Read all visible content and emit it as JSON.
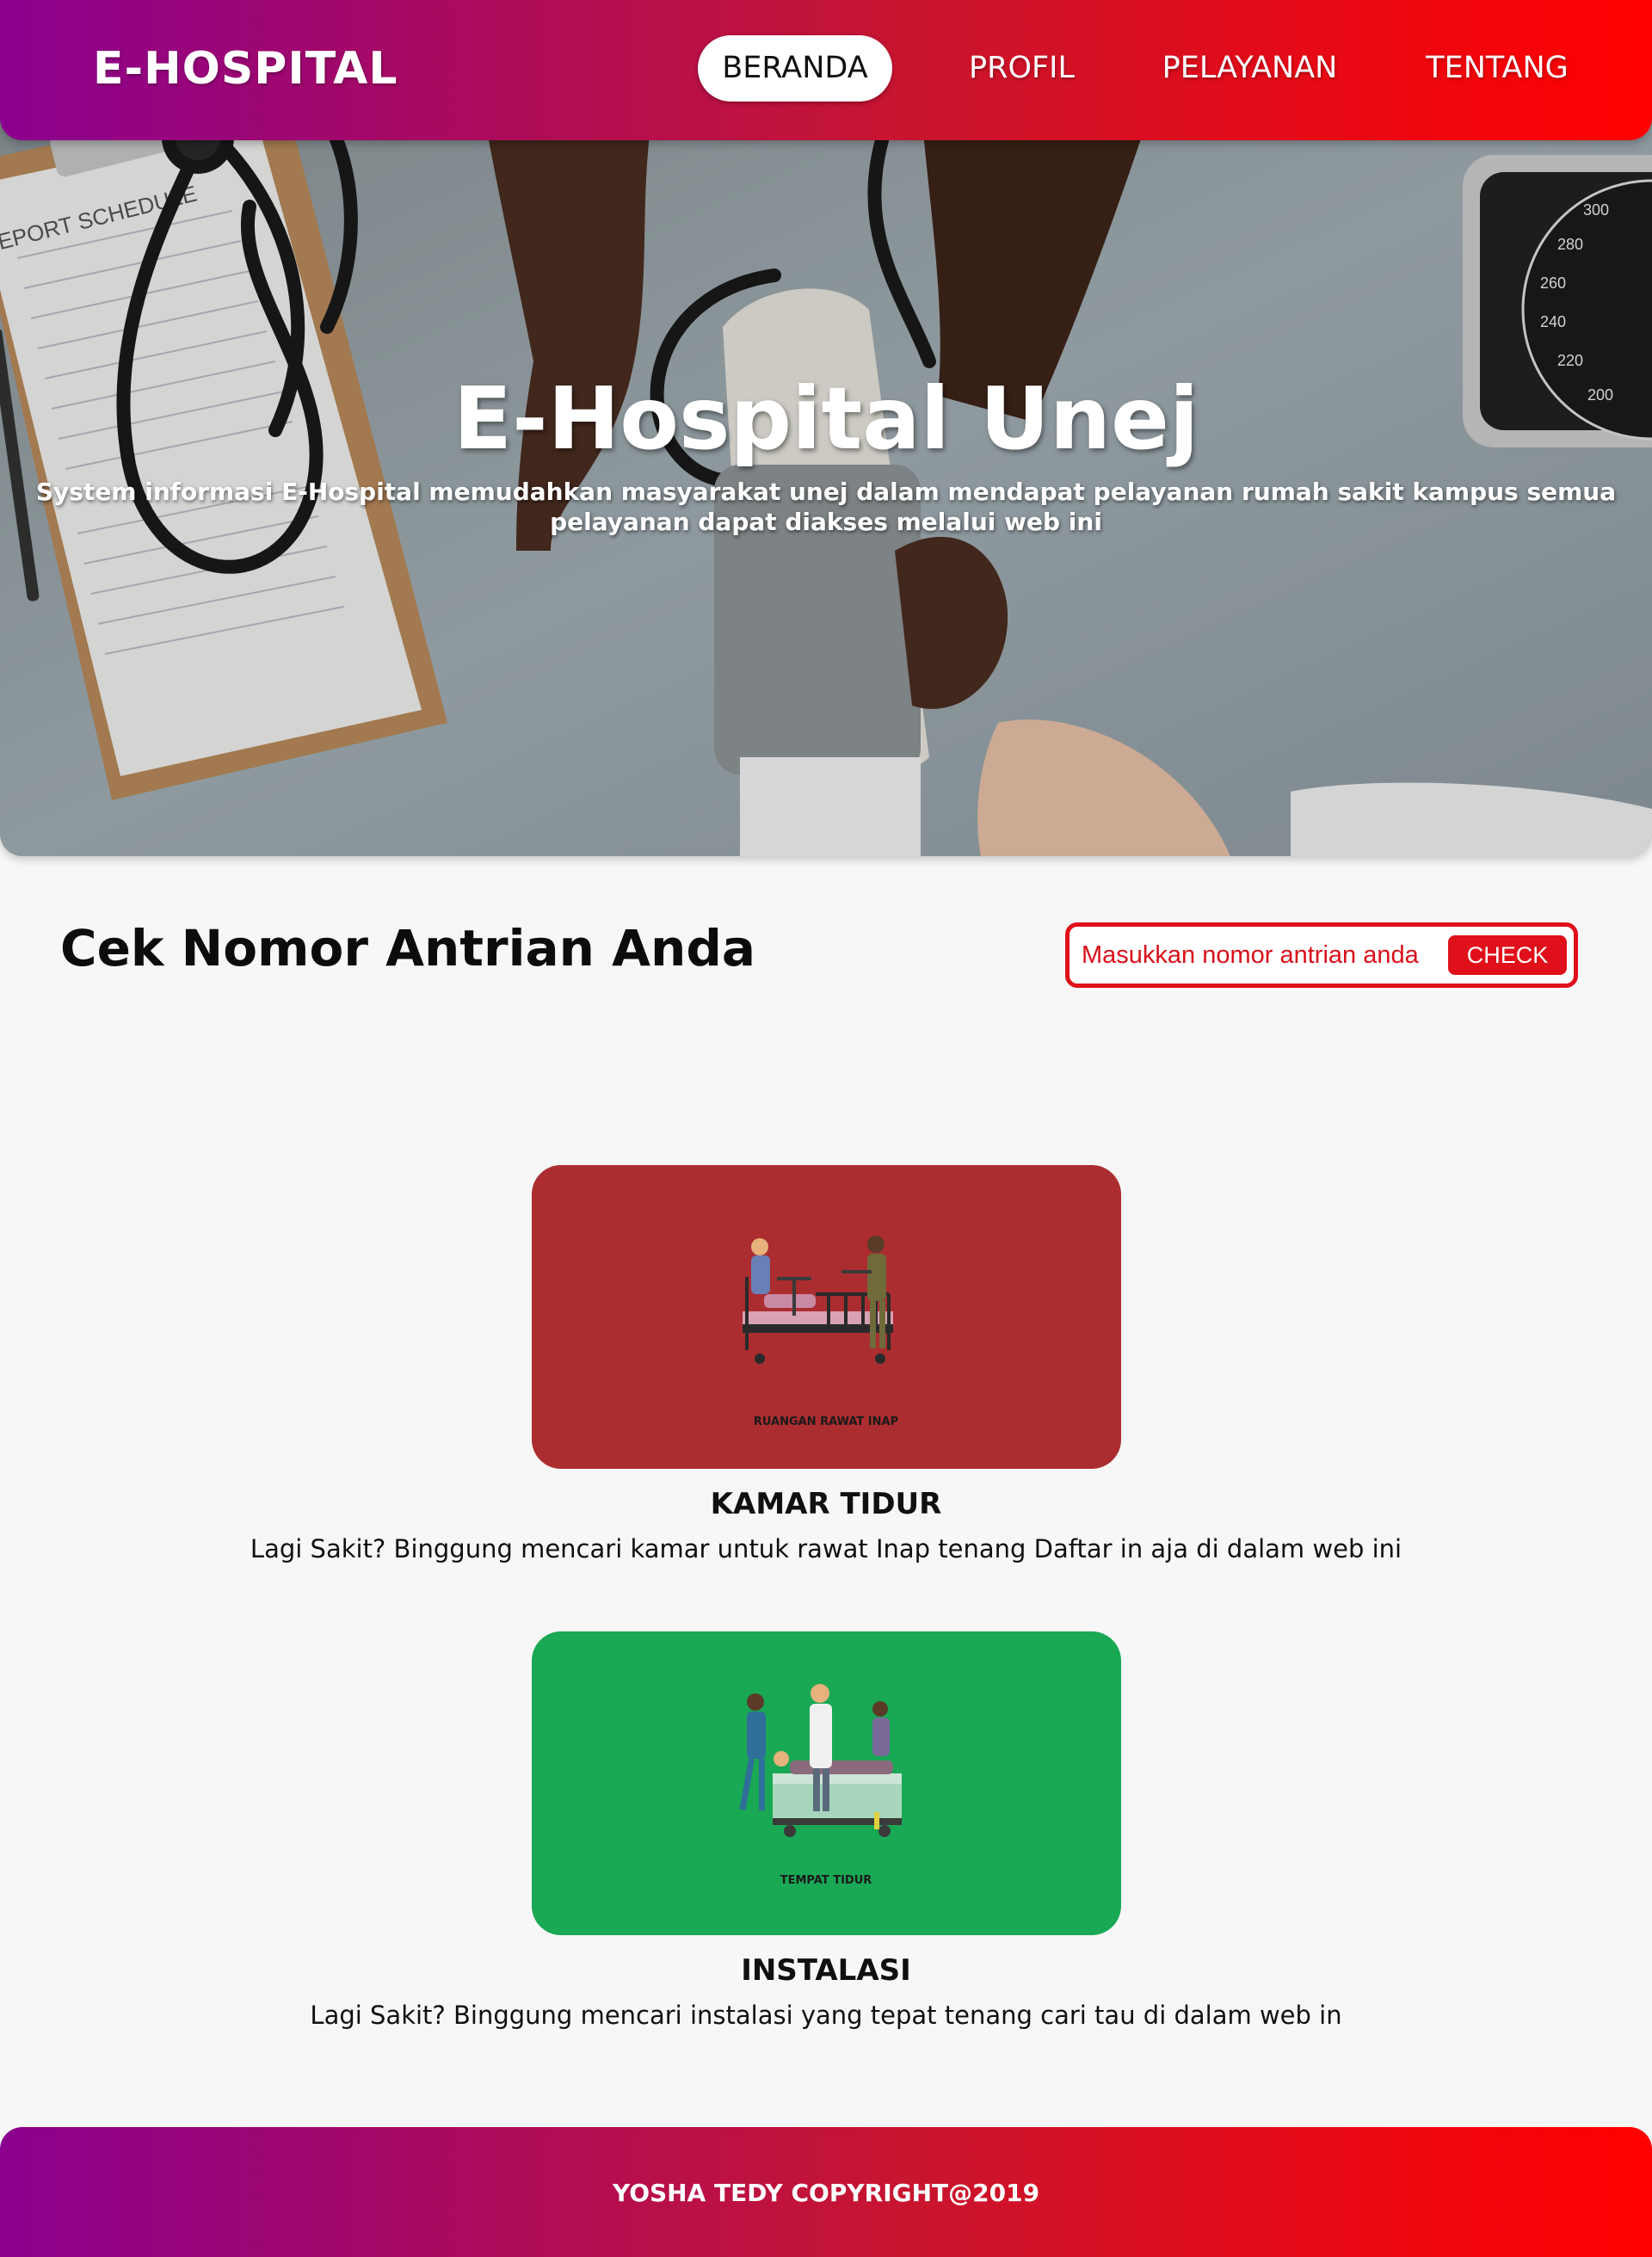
{
  "colors": {
    "gradient_start": "#8b008f",
    "gradient_end": "#ff0000",
    "accent_red": "#e0101a",
    "card_kamar": "#ab2d30",
    "card_instalasi": "#19a854",
    "page_bg": "#f7f7f7"
  },
  "navbar": {
    "brand": "E-HOSPITAL",
    "items": [
      {
        "label": "BERANDA",
        "active": true
      },
      {
        "label": "PROFIL",
        "active": false
      },
      {
        "label": "PELAYANAN",
        "active": false
      },
      {
        "label": "TENTANG",
        "active": false
      }
    ]
  },
  "hero": {
    "title": "E-Hospital Unej",
    "subtitle": "System informasi E-Hospital memudahkan masyarakat unej dalam mendapat pelayanan rumah sakit kampus semua pelayanan dapat diakses melalui web ini",
    "image_texts": {
      "clipboard_heading": "EPORT SCHEDULE",
      "gauge_numbers": [
        "300",
        "280",
        "260",
        "240",
        "220",
        "200"
      ]
    }
  },
  "queue": {
    "title": "Cek Nomor Antrian Anda",
    "input_placeholder": "Masukkan nomor antrian anda",
    "input_value": "",
    "button_label": "CHECK"
  },
  "services": [
    {
      "image_caption": "RUANGAN RAWAT INAP",
      "title": "KAMAR TIDUR",
      "description": "Lagi Sakit? Binggung mencari kamar untuk rawat Inap tenang Daftar in aja di dalam web ini"
    },
    {
      "image_caption": "TEMPAT TIDUR",
      "title": "INSTALASI",
      "description": "Lagi Sakit? Binggung mencari instalasi yang tepat tenang cari tau di dalam web in"
    }
  ],
  "footer": {
    "text": "YOSHA TEDY COPYRIGHT@2019"
  }
}
